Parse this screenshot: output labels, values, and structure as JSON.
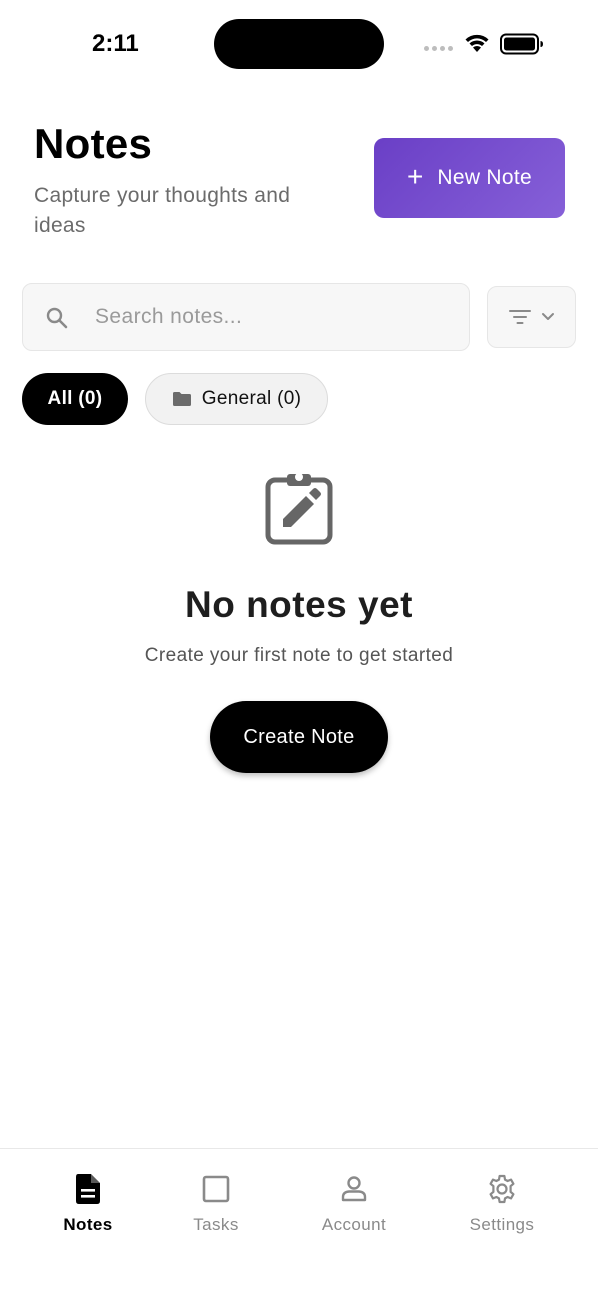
{
  "status_bar": {
    "time": "2:11"
  },
  "header": {
    "title": "Notes",
    "subtitle": "Capture your thoughts and ideas",
    "new_note_plus": "+",
    "new_note_label": "New Note"
  },
  "search": {
    "placeholder": "Search notes..."
  },
  "filters": {
    "chips": [
      {
        "label": "All (0)",
        "selected": true
      },
      {
        "label": "General (0)",
        "selected": false,
        "icon": "folder-icon"
      }
    ]
  },
  "empty_state": {
    "icon": "clipboard-edit-icon",
    "title": "No notes yet",
    "subtitle": "Create your first note to get started",
    "button_label": "Create Note"
  },
  "bottom_nav": {
    "items": [
      {
        "label": "Notes",
        "icon": "document-icon",
        "active": true
      },
      {
        "label": "Tasks",
        "icon": "square-icon",
        "active": false
      },
      {
        "label": "Account",
        "icon": "person-icon",
        "active": false
      },
      {
        "label": "Settings",
        "icon": "gear-icon",
        "active": false
      }
    ]
  },
  "colors": {
    "accent_gradient_start": "#6a3fc6",
    "accent_gradient_end": "#8660d8",
    "primary_button": "#000000",
    "muted_text": "#8a8a8a"
  }
}
